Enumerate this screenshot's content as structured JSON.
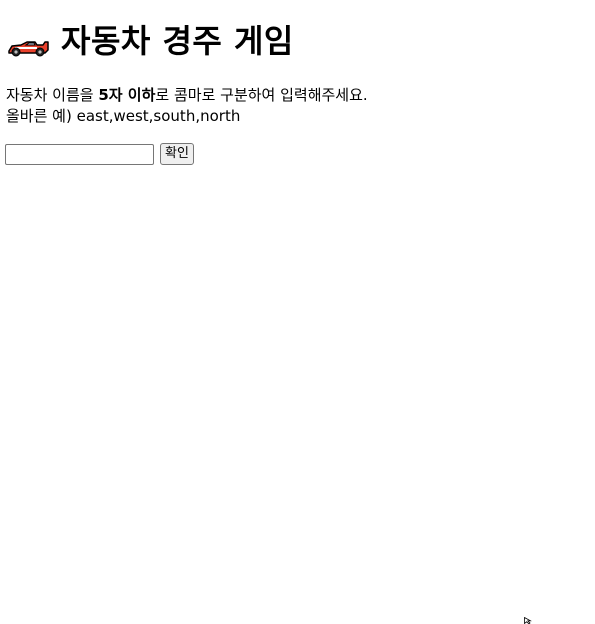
{
  "header": {
    "icon": "race-car-icon",
    "title": "자동차 경주 게임"
  },
  "instructions": {
    "line1_prefix": "자동차 이름을 ",
    "line1_bold": "5자 이하",
    "line1_suffix": "로 콤마로 구분하여 입력해주세요.",
    "line2": "올바른 예) east,west,south,north"
  },
  "form": {
    "car_names_value": "",
    "car_names_placeholder": "",
    "confirm_label": "확인"
  },
  "colors": {
    "car_body": "#e8412c",
    "car_outline": "#000000",
    "background": "#ffffff"
  }
}
